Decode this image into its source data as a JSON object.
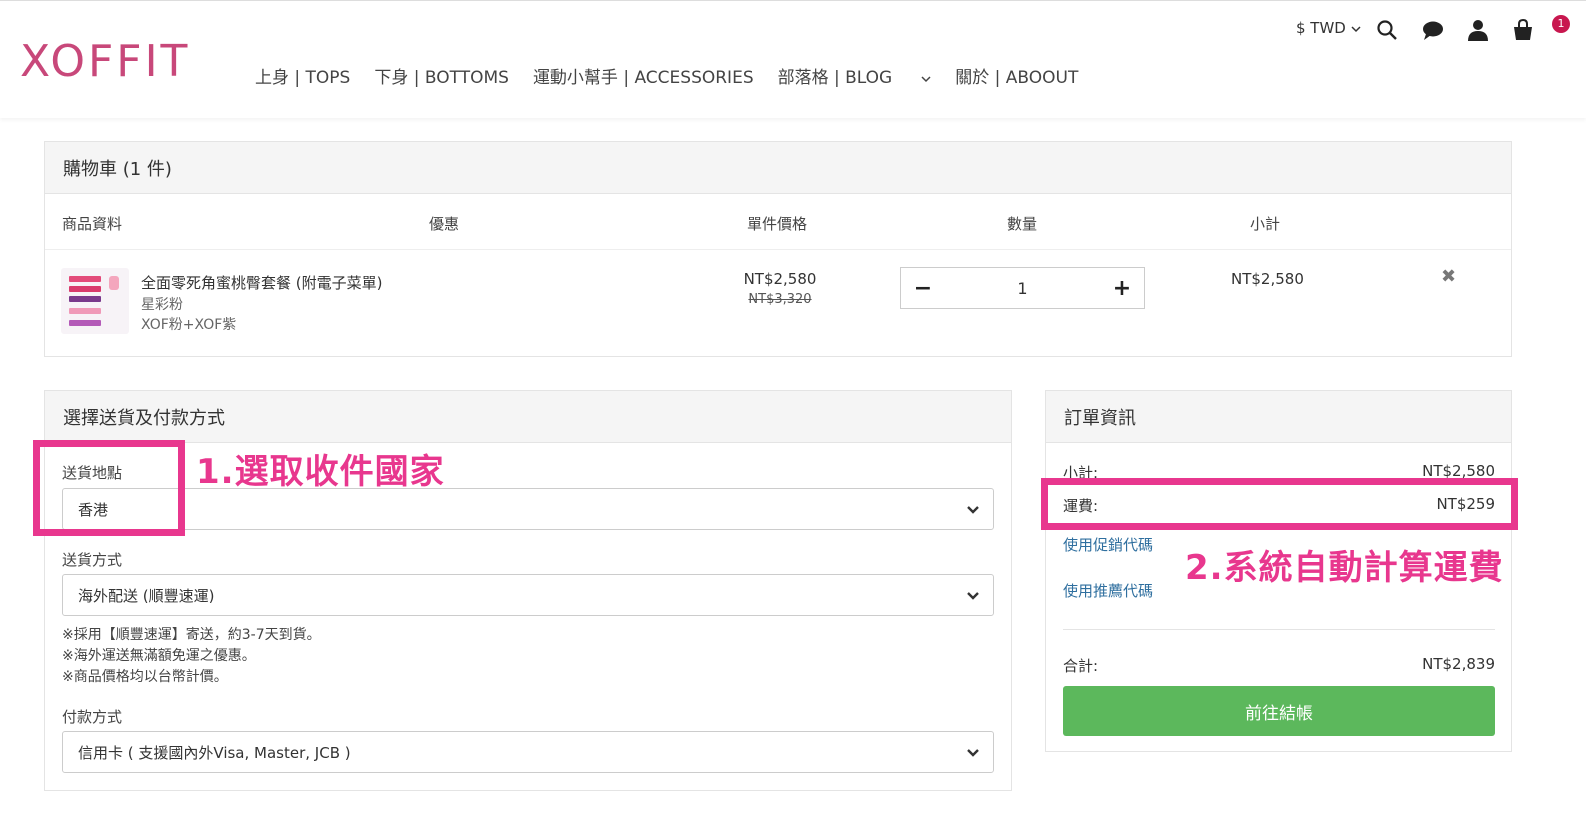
{
  "header": {
    "logo": "XOFFIT",
    "nav": [
      {
        "label": "上身 | TOPS",
        "has_dropdown": false
      },
      {
        "label": "下身 | BOTTOMS",
        "has_dropdown": false
      },
      {
        "label": "運動小幫手 | ACCESSORIES",
        "has_dropdown": false
      },
      {
        "label": "部落格 | BLOG",
        "has_dropdown": true
      },
      {
        "label": "關於 | ABOOUT",
        "has_dropdown": false
      }
    ],
    "currency": "$ TWD",
    "cart_count": "1",
    "icons": [
      "search-icon",
      "chat-icon",
      "user-icon",
      "cart-icon"
    ]
  },
  "cart": {
    "title": "購物車  (1 件)",
    "columns": {
      "product": "商品資料",
      "discount": "優惠",
      "unit_price": "單件價格",
      "quantity": "數量",
      "subtotal": "小計"
    },
    "item": {
      "name": "全面零死角蜜桃臀套餐 (附電子菜單)",
      "variant1": "星彩粉",
      "variant2": "XOF粉+XOF紫",
      "price": "NT$2,580",
      "original_price": "NT$3,320",
      "quantity": "1",
      "minus": "−",
      "plus": "+",
      "subtotal": "NT$2,580",
      "remove": "✖"
    }
  },
  "shipping": {
    "title": "選擇送貨及付款方式",
    "destination_label": "送貨地點",
    "destination_value": "香港",
    "method_label": "送貨方式",
    "method_value": "海外配送 (順豐速運)",
    "notes": [
      "※採用【順豐速運】寄送，約3-7天到貨。",
      "※海外運送無滿額免運之優惠。",
      "※商品價格均以台幣計價。"
    ],
    "payment_label": "付款方式",
    "payment_value": "信用卡 ( 支援國內外Visa, Master, JCB )"
  },
  "order": {
    "title": "訂單資訊",
    "subtotal_label": "小計:",
    "subtotal_value": "NT$2,580",
    "shipping_label": "運費:",
    "shipping_value": "NT$259",
    "promo_link": "使用促銷代碼",
    "referral_link": "使用推薦代碼",
    "total_label": "合計:",
    "total_value": "NT$2,839",
    "checkout_label": "前往結帳"
  },
  "annotations": {
    "step1": "1.選取收件國家",
    "step2": "2.系統自動計算運費",
    "color": "#e8378e"
  },
  "colors": {
    "brand": "#c8487a",
    "checkout": "#5cb85c",
    "link": "#2f6f9f"
  }
}
